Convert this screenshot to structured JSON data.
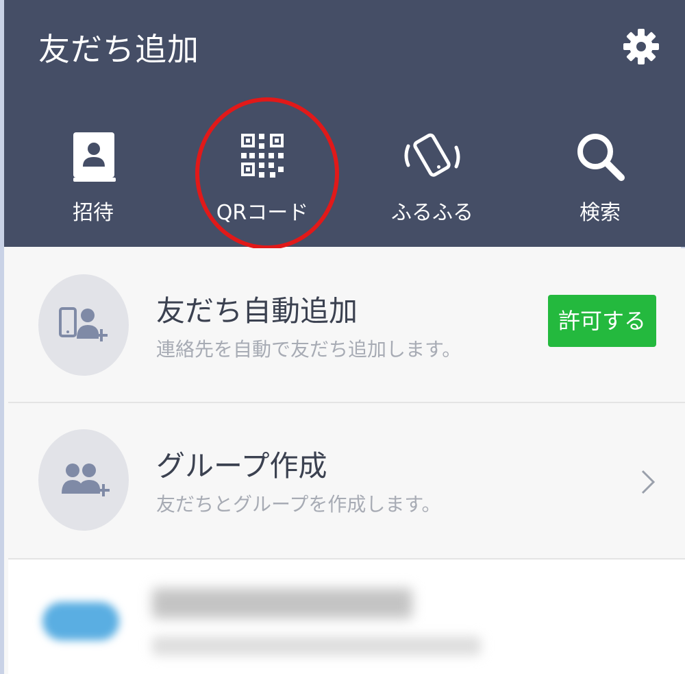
{
  "header": {
    "title": "友だち追加",
    "settings_icon": "gear-icon"
  },
  "nav": [
    {
      "label": "招待",
      "icon": "contact-book-icon"
    },
    {
      "label": "QRコード",
      "icon": "qr-code-icon"
    },
    {
      "label": "ふるふる",
      "icon": "shake-phone-icon"
    },
    {
      "label": "検索",
      "icon": "search-icon"
    }
  ],
  "rows": [
    {
      "title": "友だち自動追加",
      "subtitle": "連絡先を自動で友だち追加します。",
      "action_label": "許可する",
      "icon": "phone-add-friend-icon"
    },
    {
      "title": "グループ作成",
      "subtitle": "友だちとグループを作成します。",
      "icon": "add-group-icon"
    }
  ],
  "colors": {
    "header_bg": "#454e66",
    "accent_green": "#24b93e",
    "highlight_red": "#e11919"
  }
}
